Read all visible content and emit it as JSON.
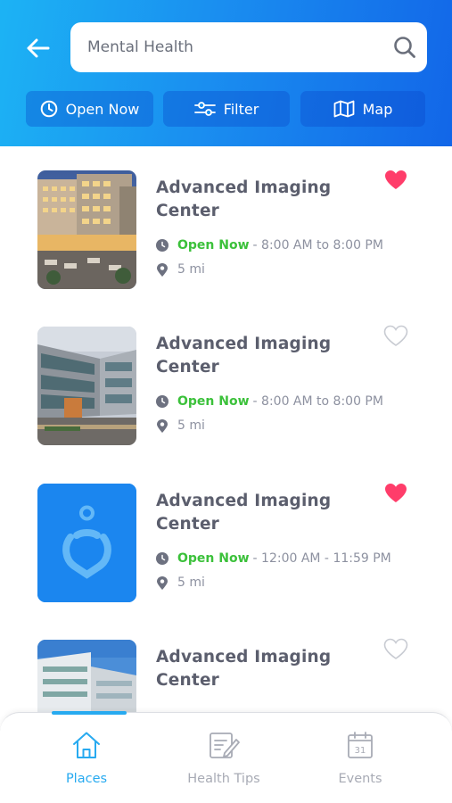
{
  "search": {
    "value": "Mental Health",
    "icon": "search-icon"
  },
  "header": {
    "back_icon": "back-arrow-icon"
  },
  "chips": [
    {
      "label": "Open Now",
      "icon": "clock-icon"
    },
    {
      "label": "Filter",
      "icon": "sliders-icon"
    },
    {
      "label": "Map",
      "icon": "map-icon"
    }
  ],
  "places": [
    {
      "name_line1": "Advanced Imaging",
      "name_line2": "Center",
      "status": "Open Now",
      "hours": "- 8:00 AM to 8:00 PM",
      "distance": "5 mi",
      "favorite": true,
      "image": "hospital-night-photo"
    },
    {
      "name_line1": "Advanced Imaging",
      "name_line2": "Center",
      "status": "Open Now",
      "hours": "- 8:00 AM to 8:00 PM",
      "distance": "5 mi",
      "favorite": false,
      "image": "hospital-building-photo"
    },
    {
      "name_line1": "Advanced Imaging",
      "name_line2": "Center",
      "status": "Open Now",
      "hours": "- 12:00 AM - 11:59 PM",
      "distance": "5 mi",
      "favorite": true,
      "image": "location-pin-logo"
    },
    {
      "name_line1": "Advanced Imaging",
      "name_line2": "Center",
      "favorite": false,
      "image": "hospital-modern-photo"
    }
  ],
  "nav": [
    {
      "label": "Places",
      "icon": "home-icon",
      "active": true
    },
    {
      "label": "Health Tips",
      "icon": "notepad-icon",
      "active": false
    },
    {
      "label": "Events",
      "icon": "calendar-icon",
      "active": false,
      "calendar_day": "31"
    }
  ],
  "colors": {
    "accent": "#27aaf0",
    "open_green": "#3cc13b",
    "heart_red": "#ff3d6a",
    "header_start": "#1cb3f4",
    "header_end": "#1266e8"
  }
}
